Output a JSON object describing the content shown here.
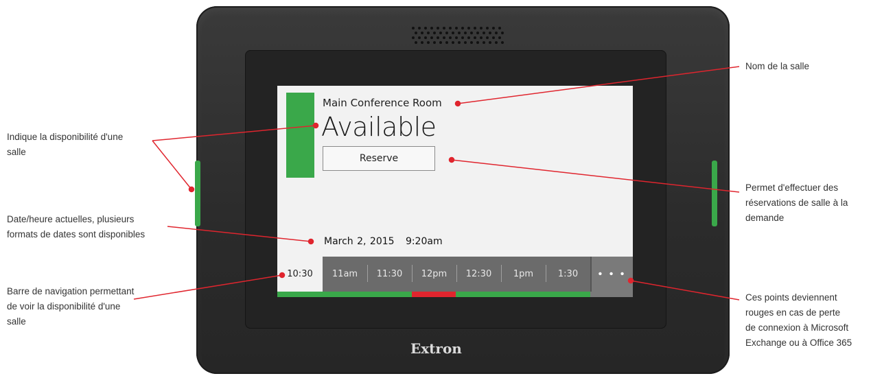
{
  "device": {
    "brand": "Extron",
    "screen": {
      "room_name": "Main Conference Room",
      "status": "Available",
      "status_color": "#3aa84a",
      "reserve_label": "Reserve",
      "date": "March 2, 2015",
      "time": "9:20am",
      "nav": {
        "current": "10:30",
        "slots": [
          "11am",
          "11:30",
          "12pm",
          "12:30",
          "1pm",
          "1:30"
        ],
        "more_label": "• • •"
      },
      "availability_colors": {
        "free": "#3aa84a",
        "busy": "#e0252e"
      }
    }
  },
  "annotations": {
    "availability": [
      "Indique la disponibilité d'une",
      "salle"
    ],
    "datetime": [
      "Date/heure actuelles, plusieurs",
      "formats de dates sont disponibles"
    ],
    "nav_bar": [
      "Barre de navigation permettant",
      "de voir la disponibilité d'une",
      "salle"
    ],
    "room_name": [
      "Nom de la salle"
    ],
    "reserve": [
      "Permet d'effectuer des",
      "réservations de salle à la",
      "demande"
    ],
    "dots": [
      "Ces points deviennent",
      "rouges en cas de perte",
      "de connexion à Microsoft",
      "Exchange ou à Office 365"
    ]
  },
  "accent_color": "#e0252e"
}
